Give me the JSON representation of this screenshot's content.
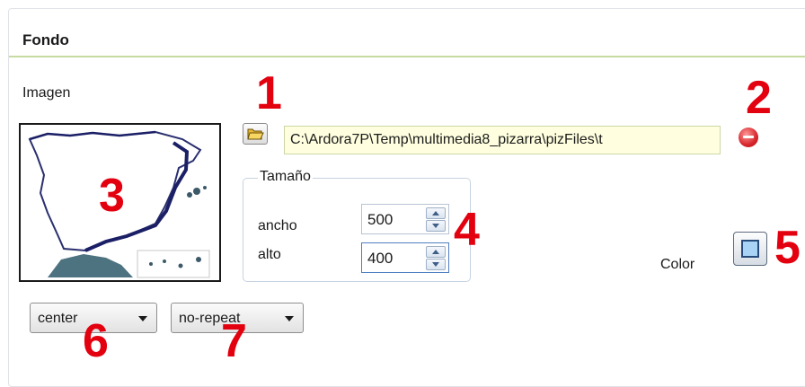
{
  "section": {
    "title": "Fondo"
  },
  "image": {
    "label": "Imagen",
    "path": "C:\\Ardora7P\\Temp\\multimedia8_pizarra\\pizFiles\\t",
    "browse_icon": "folder-open-icon",
    "remove_icon": "remove-icon"
  },
  "size": {
    "legend": "Tamaño",
    "width_label": "ancho",
    "width_value": "500",
    "height_label": "alto",
    "height_value": "400"
  },
  "color": {
    "label": "Color",
    "swatch": "#a8d3f4"
  },
  "position_select": {
    "value": "center"
  },
  "repeat_select": {
    "value": "no-repeat"
  },
  "callouts": [
    "1",
    "2",
    "3",
    "4",
    "5",
    "6",
    "7"
  ],
  "colors": {
    "callout": "#e3000f",
    "divider": "#c6dba0",
    "path_bg": "#ffffe0"
  }
}
